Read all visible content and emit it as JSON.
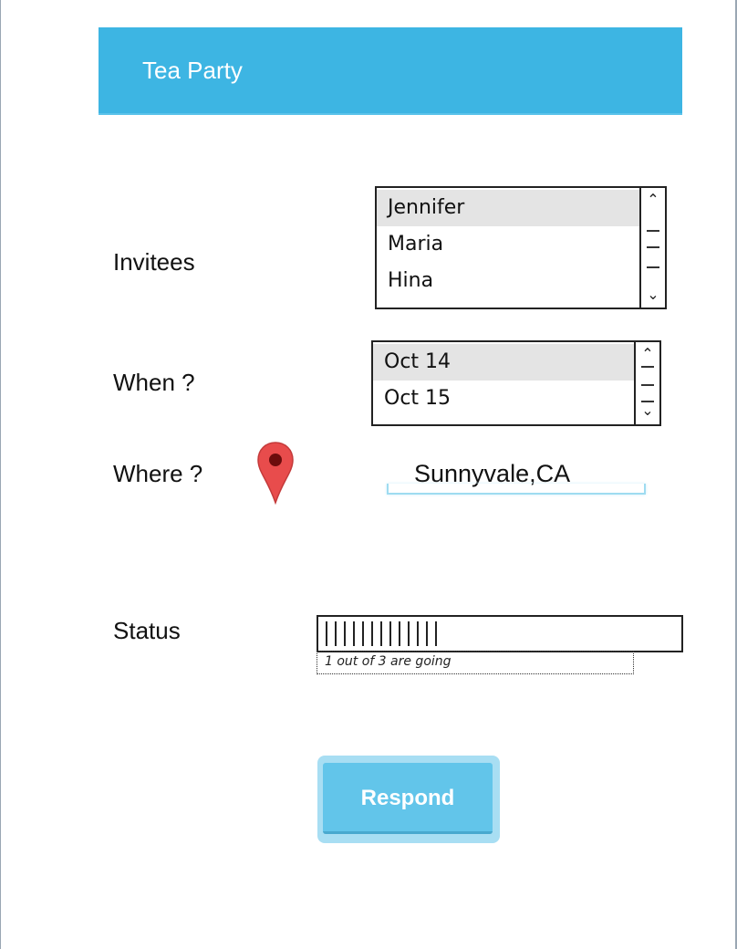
{
  "header": {
    "title": "Tea Party"
  },
  "invitees": {
    "label": "Invitees",
    "items": [
      {
        "name": "Jennifer",
        "selected": true
      },
      {
        "name": "Maria",
        "selected": false
      },
      {
        "name": "Hina",
        "selected": false
      }
    ]
  },
  "when": {
    "label": "When ?",
    "items": [
      {
        "name": "Oct 14",
        "selected": true
      },
      {
        "name": "Oct 15",
        "selected": false
      }
    ]
  },
  "where": {
    "label": "Where ?",
    "icon": "map-pin-icon",
    "value": "Sunnyvale,CA"
  },
  "status": {
    "label": "Status",
    "progress_fraction": 0.33,
    "caption": "1 out of 3 are going"
  },
  "actions": {
    "respond_label": "Respond"
  },
  "colors": {
    "header_bg": "#3db5e3",
    "button_bg": "#62c5ea",
    "pin": "#e84c4c"
  }
}
